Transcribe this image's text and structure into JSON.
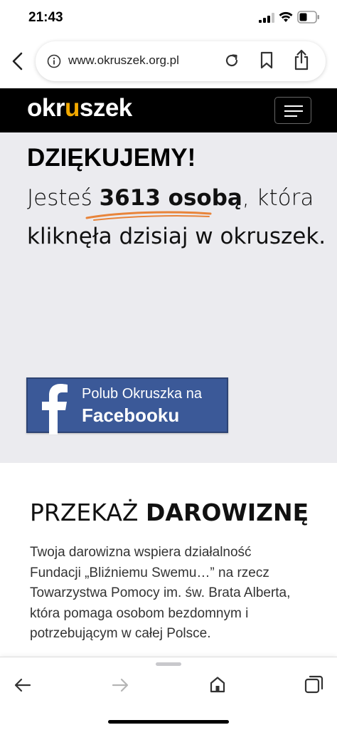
{
  "status_bar": {
    "time": "21:43"
  },
  "browser": {
    "url": "www.okruszek.org.pl"
  },
  "site": {
    "logo_main": "okr",
    "logo_accent": "u",
    "logo_rest": "szek",
    "accent_color": "#f2a900"
  },
  "hero": {
    "thanks": "DZIĘKUJEMY!",
    "line1_before": "Jesteś ",
    "line1_bold": "3613 osobą",
    "line1_after": ", która",
    "line2": "kliknęła dzisiaj w okruszek.",
    "swash_color": "#e8843a"
  },
  "facebook": {
    "line1": "Polub Okruszka na",
    "line2": "Facebooku",
    "color": "#3b5998"
  },
  "donation": {
    "title_light": "PRZEKAŻ ",
    "title_bold": "DAROWIZNĘ",
    "text": "Twoja darowizna wspiera działalność Fundacji „Bliźniemu Swemu…” na rzecz Towarzystwa Pomocy im. św. Brata Alberta, która pomaga osobom bezdomnym i potrzebującym w całej Polsce."
  },
  "icons": {
    "back": "back-arrow-icon",
    "info": "info-icon",
    "reload": "reload-icon",
    "bookmark": "bookmark-icon",
    "share": "share-icon",
    "home": "home-icon",
    "tabs": "tabs-icon"
  }
}
